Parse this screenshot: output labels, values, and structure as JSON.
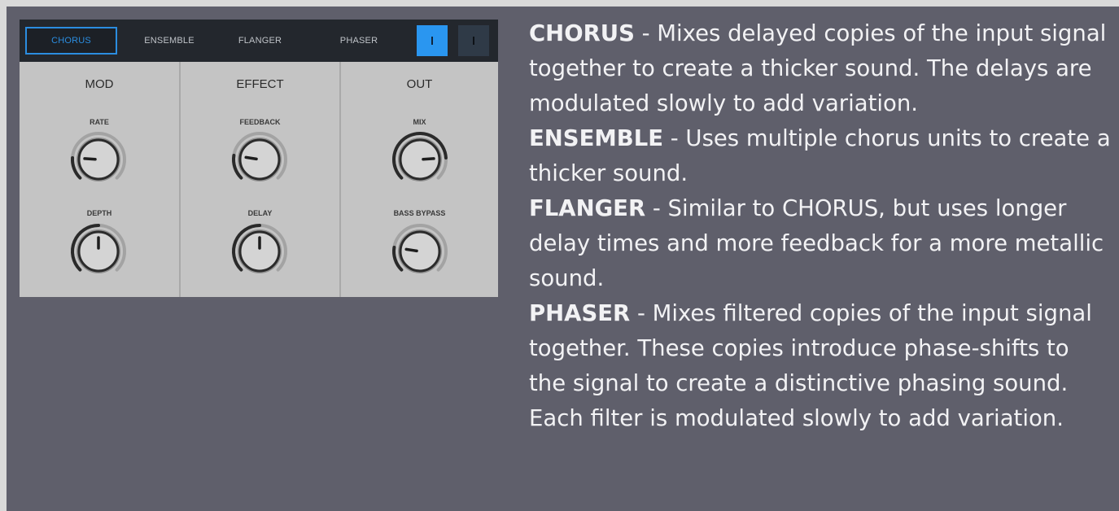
{
  "tabs": [
    {
      "label": "CHORUS",
      "active": true
    },
    {
      "label": "ENSEMBLE",
      "active": false
    },
    {
      "label": "FLANGER",
      "active": false
    },
    {
      "label": "PHASER",
      "active": false
    }
  ],
  "toggles": {
    "on_state": "on",
    "off_state": "off"
  },
  "sections": {
    "mod": {
      "title": "MOD",
      "param1": "RATE",
      "param2": "DEPTH"
    },
    "effect": {
      "title": "EFFECT",
      "param1": "FEEDBACK",
      "param2": "DELAY"
    },
    "out": {
      "title": "OUT",
      "param1": "MIX",
      "param2": "BASS BYPASS"
    }
  },
  "knob_values": {
    "rate": 0.18,
    "depth": 0.5,
    "feedback": 0.2,
    "delay": 0.5,
    "mix": 0.82,
    "bass_bypass": 0.2
  },
  "colors": {
    "accent": "#2b8de0",
    "page_bg": "#5f5f6b",
    "panel_bg": "#c4c4c4",
    "tabbar_bg": "#23272d",
    "text": "#f2f2f4"
  },
  "descriptions": [
    {
      "name": "CHORUS",
      "text": " - Mixes delayed copies of the input signal together to create a thicker sound. The delays are modulated slowly to add variation."
    },
    {
      "name": "ENSEMBLE",
      "text": " - Uses multiple chorus units to create a thicker sound."
    },
    {
      "name": "FLANGER",
      "text": " - Similar to CHORUS, but uses longer delay times and more feedback for a more metallic sound."
    },
    {
      "name": "PHASER",
      "text": " - Mixes filtered copies of the input signal together. These copies introduce phase-shifts to the signal to create a distinctive phasing sound. Each filter is modulated slowly to add variation."
    }
  ]
}
